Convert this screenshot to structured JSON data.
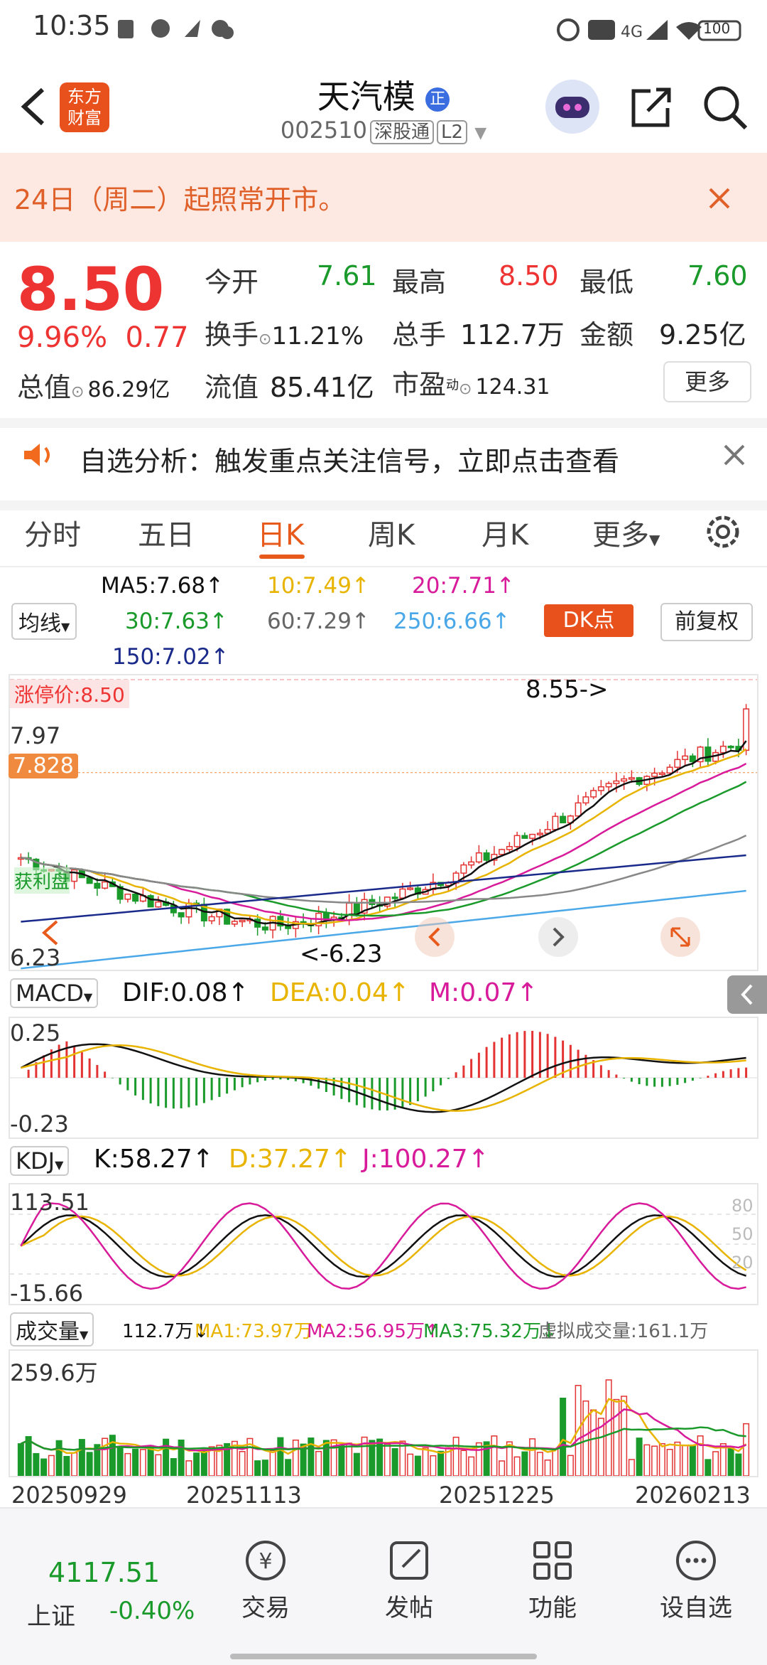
{
  "status_bar": {
    "time": "10:35",
    "network": "4G",
    "battery": "100"
  },
  "header": {
    "title": "天汽模",
    "code": "002510",
    "tag_market": "深股通",
    "tag_level": "L2",
    "logo_text_1": "东方",
    "logo_text_2": "财富"
  },
  "notice": {
    "text": "24日（周二）起照常开市。"
  },
  "quote": {
    "price": "8.50",
    "change_pct": "9.96%",
    "change": "0.77",
    "total_value_label": "总值",
    "total_value": "86.29亿",
    "open_label": "今开",
    "open": "7.61",
    "high_label": "最高",
    "high": "8.50",
    "low_label": "最低",
    "low": "7.60",
    "turnover_label": "换手",
    "turnover": "11.21%",
    "volume_label": "总手",
    "volume": "112.7万",
    "amount_label": "金额",
    "amount": "9.25亿",
    "float_label": "流值",
    "float_value": "85.41亿",
    "pe_label": "市盈",
    "pe_sup": "动",
    "pe": "124.31",
    "more_label": "更多"
  },
  "analysis": {
    "text": "自选分析：触发重点关注信号，立即点击查看"
  },
  "tabs": [
    "分时",
    "五日",
    "日K",
    "周K",
    "月K",
    "更多"
  ],
  "active_tab": "日K",
  "ma_legend": {
    "selector": "均线",
    "ma5": "MA5:7.68↑",
    "ma10": "10:7.49↑",
    "ma20": "20:7.71↑",
    "ma30": "30:7.63↑",
    "ma60": "60:7.29↑",
    "ma250": "250:6.66↑",
    "ma150": "150:7.02↑",
    "dk_button": "DK点",
    "fq_button": "前复权"
  },
  "kline": {
    "limit_label": "涨停价:8.50",
    "price_top": "8.55",
    "ticks": [
      "7.97",
      "7.828",
      "7.3",
      "6.96",
      "6.6",
      "6.23"
    ],
    "max_label": "8.55->",
    "min_label": "<-6.23",
    "cost_label": "获利盘",
    "colors": {
      "up": "#e33333",
      "down": "#1a9a2a",
      "ma5": "#111111",
      "ma10": "#e8b400",
      "ma20": "#d81b9a",
      "ma30": "#1a9a2a",
      "ma60": "#888888",
      "ma150": "#1a2a8a",
      "ma250": "#4aa8e8"
    }
  },
  "macd": {
    "selector": "MACD",
    "dif": "DIF:0.08↑",
    "dea": "DEA:0.04↑",
    "m": "M:0.07↑",
    "top": "0.25",
    "bottom": "-0.23"
  },
  "kdj": {
    "selector": "KDJ",
    "k": "K:58.27↑",
    "d": "D:37.27↑",
    "j": "J:100.27↑",
    "top": "113.51",
    "bottom": "-15.66",
    "r80": "80",
    "r50": "50",
    "r20": "20"
  },
  "volume": {
    "selector": "成交量",
    "vol": "112.7万↓",
    "ma1": "MA1:73.97万↑",
    "ma2": "MA2:56.95万↑",
    "ma3": "MA3:75.32万↓",
    "virtual": "虚拟成交量:161.1万",
    "top": "259.6万"
  },
  "dates": [
    "20250929",
    "20251113",
    "20251225",
    "20260213"
  ],
  "bottom_nav": {
    "index_value": "4117.51",
    "index_name": "上证",
    "index_change": "-0.40%",
    "trade": "交易",
    "post": "发帖",
    "function": "功能",
    "watchlist": "设自选"
  }
}
